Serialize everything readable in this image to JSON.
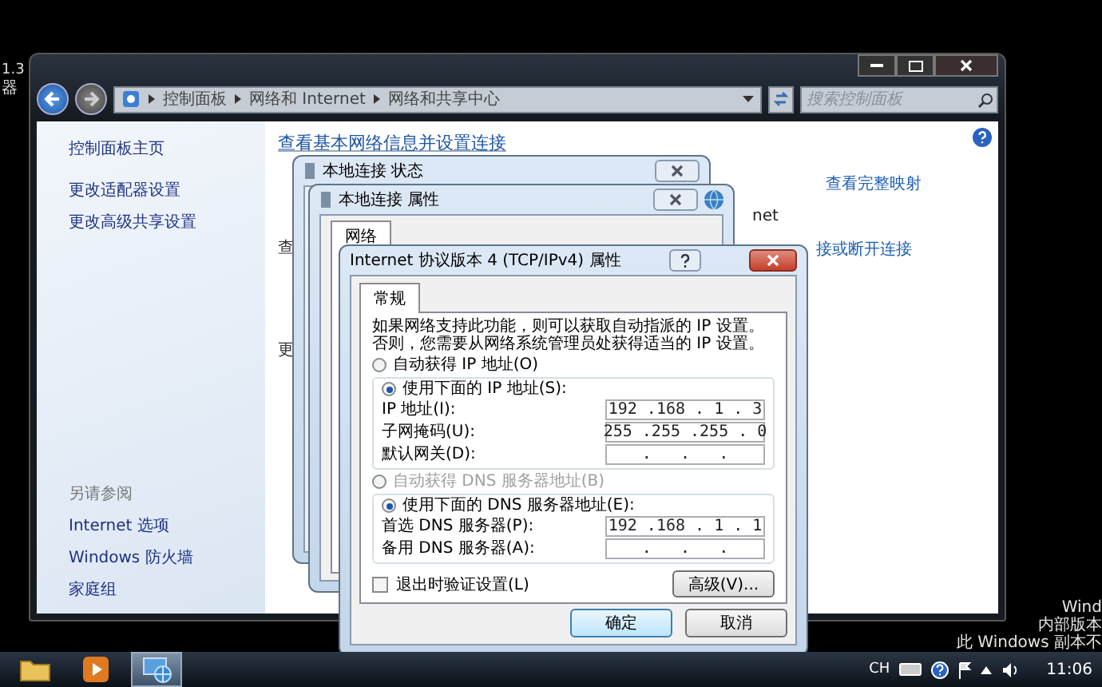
{
  "desktop": {
    "icon_labels": [
      "1.3",
      "器"
    ],
    "watermark": [
      "Wind",
      "内部版本",
      "此 Windows 副本不"
    ]
  },
  "explorer": {
    "breadcrumbs": [
      "控制面板",
      "网络和 Internet",
      "网络和共享中心"
    ],
    "search": {
      "placeholder": "搜索控制面板"
    },
    "sidebar": {
      "links": [
        "控制面板主页",
        "更改适配器设置",
        "更改高级共享设置"
      ],
      "see_also_title": "另请参阅",
      "see_also": [
        "Internet 选项",
        "Windows 防火墙",
        "家庭组"
      ]
    },
    "heading": "查看基本网络信息并设置连接",
    "left_fragments": [
      "查",
      "更"
    ],
    "right_texts": [
      {
        "kind": "link",
        "text": "查看完整映射"
      },
      {
        "kind": "plain",
        "text": "net"
      },
      {
        "kind": "link",
        "text": "接或断开连接"
      }
    ]
  },
  "status_dialog": {
    "title": "本地连接 状态"
  },
  "properties_dialog": {
    "title": "本地连接 属性",
    "tabs": [
      {
        "label": "网络",
        "selected": true
      }
    ]
  },
  "tcp_dialog": {
    "title": "Internet 协议版本 4 (TCP/IPv4) 属性",
    "tabs": [
      {
        "label": "常规",
        "selected": true
      }
    ],
    "description": "如果网络支持此功能，则可以获取自动指派的 IP 设置。否则，您需要从网络系统管理员处获得适当的 IP 设置。",
    "auto_ip": {
      "label": "自动获得 IP 地址(O)",
      "selected": false,
      "disabled": false
    },
    "manual_ip": {
      "label": "使用下面的 IP 地址(S):",
      "selected": true,
      "disabled": false
    },
    "ip_fields": [
      {
        "label": "IP 地址(I):",
        "value": "192 .168 . 1 . 3"
      },
      {
        "label": "子网掩码(U):",
        "value": "255 .255 .255 . 0"
      },
      {
        "label": "默认网关(D):",
        "value": ".   .   ."
      }
    ],
    "auto_dns": {
      "label": "自动获得 DNS 服务器地址(B)",
      "selected": false,
      "disabled": true
    },
    "manual_dns": {
      "label": "使用下面的 DNS 服务器地址(E):",
      "selected": true,
      "disabled": false
    },
    "dns_fields": [
      {
        "label": "首选 DNS 服务器(P):",
        "value": "192 .168 . 1 . 1"
      },
      {
        "label": "备用 DNS 服务器(A):",
        "value": ".   .   ."
      }
    ],
    "validate": {
      "label": "退出时验证设置(L)",
      "checked": false
    },
    "advanced_button": "高级(V)...",
    "buttons": [
      {
        "label": "确定",
        "default": true
      },
      {
        "label": "取消",
        "default": false
      }
    ]
  },
  "taskbar": {
    "apps": [
      {
        "kind": "folder",
        "active": false
      },
      {
        "kind": "media",
        "active": false
      },
      {
        "kind": "network",
        "active": true
      }
    ],
    "language": "CH",
    "clock": "11:06"
  }
}
